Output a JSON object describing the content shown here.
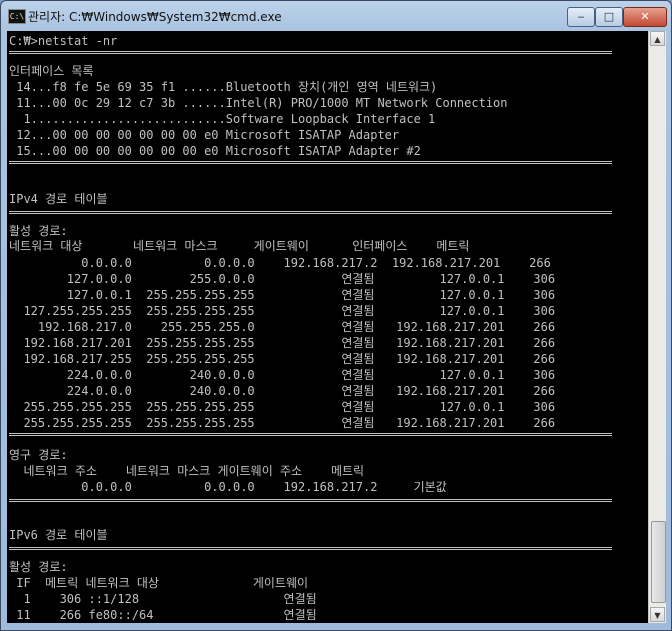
{
  "window": {
    "title": "관리자: C:₩Windows₩System32₩cmd.exe",
    "app_icon_label": "C:\\",
    "controls": {
      "minimize": "‒",
      "maximize": "□",
      "close": "✕"
    }
  },
  "console": {
    "lines": [
      "C:₩>netstat -nr",
      "인터페이스 목록",
      " 14...f8 fe 5e 69 35 f1 ......Bluetooth 장치(개인 영역 네트워크)",
      " 11...00 0c 29 12 c7 3b ......Intel(R) PRO/1000 MT Network Connection",
      "  1...........................Software Loopback Interface 1",
      " 12...00 00 00 00 00 00 00 e0 Microsoft ISATAP Adapter",
      " 15...00 00 00 00 00 00 00 e0 Microsoft ISATAP Adapter #2",
      "IPv4 경로 테이블",
      "활성 경로:",
      "네트워크 대상       네트워크 마스크     게이트웨이      인터페이스    메트릭",
      "          0.0.0.0          0.0.0.0    192.168.217.2  192.168.217.201    266",
      "        127.0.0.0        255.0.0.0            연결됨         127.0.0.1    306",
      "        127.0.0.1  255.255.255.255            연결됨         127.0.0.1    306",
      "  127.255.255.255  255.255.255.255            연결됨         127.0.0.1    306",
      "    192.168.217.0    255.255.255.0            연결됨   192.168.217.201    266",
      "  192.168.217.201  255.255.255.255            연결됨   192.168.217.201    266",
      "  192.168.217.255  255.255.255.255            연결됨   192.168.217.201    266",
      "        224.0.0.0        240.0.0.0            연결됨         127.0.0.1    306",
      "        224.0.0.0        240.0.0.0            연결됨   192.168.217.201    266",
      "  255.255.255.255  255.255.255.255            연결됨         127.0.0.1    306",
      "  255.255.255.255  255.255.255.255            연결됨   192.168.217.201    266",
      "영구 경로:",
      "  네트워크 주소    네트워크 마스크 게이트웨이 주소    메트릭",
      "          0.0.0.0          0.0.0.0    192.168.217.2     기본값",
      "IPv6 경로 테이블",
      "활성 경로:",
      " IF  메트릭 네트워크 대상             게이트웨이",
      "  1    306 ::1/128                    연결됨",
      " 11    266 fe80::/64                  연결됨"
    ]
  }
}
